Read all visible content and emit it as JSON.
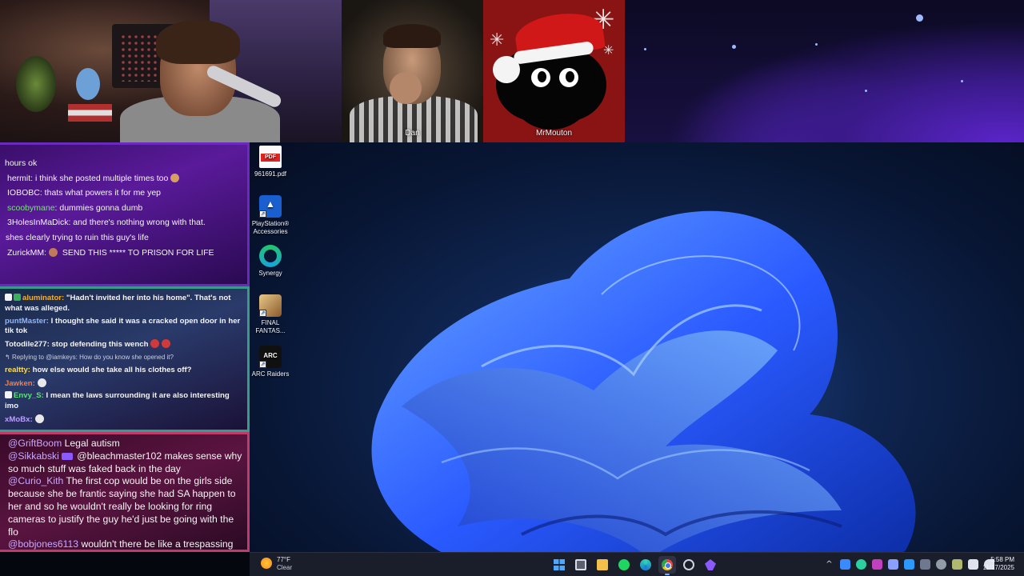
{
  "cameras": {
    "guest1_name": "Dan",
    "guest2_name": "MrMouton"
  },
  "chat_panel_1": {
    "lines": [
      {
        "user": "",
        "text": "hours ok"
      },
      {
        "user": "hermit:",
        "text": " i think she posted multiple times too"
      },
      {
        "user": "IOBOBC:",
        "text": " thats what powers it for me yep"
      },
      {
        "user": "scoobymane",
        "text": ": dummies gonna dumb"
      },
      {
        "user": "3HolesInMaDick:",
        "text": " and there's nothing wrong with that."
      },
      {
        "user": "",
        "text": "shes clearly trying to ruin this guy's life"
      },
      {
        "user": "ZurickMM:",
        "text": " SEND THIS ***** TO PRISON FOR LIFE"
      }
    ],
    "colors": {
      "hermit": "#f4f4f8",
      "IOBOBC": "#f4f4f8",
      "scoobymane": "#7be07b",
      "3HolesInMaDick": "#f4f4f8",
      "ZurickMM": "#f4f4f8"
    }
  },
  "chat_panel_2": {
    "lines": [
      {
        "user": "aluminator:",
        "text": " \"Hadn't invited her into his home\". That's not what was alleged.",
        "color": "#f0b030"
      },
      {
        "user": "puntMaster:",
        "text": " I thought she said it was a cracked open door in her tik tok",
        "color": "#8fb8ff"
      },
      {
        "user": "Totodile277:",
        "text": " stop defending this wench",
        "color": "#f4f4f8"
      },
      {
        "user": "",
        "text": "Replying to @iamkeys: How do you know she opened it?",
        "color": "#c8d0e0",
        "reply": true
      },
      {
        "user": "realtty:",
        "text": " how else would she take all his clothes off?",
        "color": "#ffdd55"
      },
      {
        "user": "Jawken:",
        "text": "",
        "color": "#ff7a3a"
      },
      {
        "user": "Envy_S:",
        "text": " I mean the laws surrounding it are also interesting imo",
        "color": "#5ee07a"
      },
      {
        "user": "xMoBx:",
        "text": "",
        "color": "#b8a0ff"
      }
    ]
  },
  "chat_panel_3": {
    "lines": [
      {
        "user": "@GriftBoom",
        "text": " Legal autism"
      },
      {
        "user": "@Sikkabski",
        "text": " @bleachmaster102 makes sense why so much stuff was faked back in the day"
      },
      {
        "user": "@Curio_Kith",
        "text": " The first cop would be on the girls side because she be frantic saying she had SA happen to her and so he wouldn't really be looking for ring cameras to justify the guy he'd just be going with the flo"
      },
      {
        "user": "@bobjones6113",
        "text": " wouldn't there be like a trespassing charge then?"
      }
    ],
    "user_color": "#c8a8ff"
  },
  "desktop_icons": [
    {
      "label": "961691.pdf",
      "icon": "pdf-file-icon"
    },
    {
      "label": "PlayStation® Accessories",
      "icon": "playstation-icon"
    },
    {
      "label": "Synergy",
      "icon": "synergy-icon"
    },
    {
      "label": "FINAL FANTAS...",
      "icon": "final-fantasy-icon"
    },
    {
      "label": "ARC Raiders",
      "icon": "arc-raiders-icon"
    }
  ],
  "taskbar": {
    "weather_temp": "77°F",
    "weather_desc": "Clear",
    "apps": [
      "start-icon",
      "task-view-icon",
      "file-explorer-icon",
      "spotify-icon",
      "edge-icon",
      "chrome-icon",
      "steam-icon",
      "purple-app-icon"
    ],
    "active_app": "chrome-icon",
    "time": "5:58 PM",
    "date": "11/17/2025"
  },
  "colors": {
    "chat1_border": "#6a2ac0",
    "chat2_border": "#3a9a8a",
    "chat3_border": "#c03a6a",
    "taskbar_bg": "#1a1d2a",
    "wallpaper_accent": "#2a6aff"
  }
}
